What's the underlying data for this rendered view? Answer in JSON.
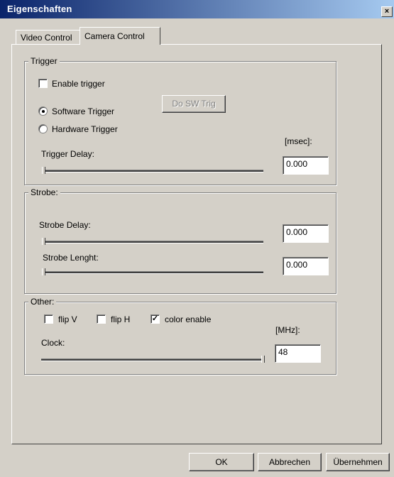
{
  "window": {
    "title": "Eigenschaften",
    "close_label": "×"
  },
  "tabs": [
    {
      "label": "Video Control"
    },
    {
      "label": "Camera Control"
    }
  ],
  "trigger": {
    "group_label": "Trigger",
    "enable_label": "Enable trigger",
    "enable_checked": false,
    "software_label": "Software Trigger",
    "hardware_label": "Hardware Trigger",
    "selected_mode": "Software Trigger",
    "do_sw_trig_label": "Do SW Trig",
    "unit_label": "[msec]:",
    "delay_label": "Trigger Delay:",
    "delay_value": "0.000",
    "delay_slider_fraction": 0.0
  },
  "strobe": {
    "group_label": "Strobe:",
    "delay_label": "Strobe Delay:",
    "delay_value": "0.000",
    "delay_slider_fraction": 0.0,
    "length_label": "Strobe Lenght:",
    "length_value": "0.000",
    "length_slider_fraction": 0.0
  },
  "other": {
    "group_label": "Other:",
    "flip_v_label": "flip V",
    "flip_v_checked": false,
    "flip_h_label": "flip H",
    "flip_h_checked": false,
    "color_enable_label": "color enable",
    "color_enable_checked": true,
    "unit_label": "[MHz]:",
    "clock_label": "Clock:",
    "clock_value": "48",
    "clock_slider_fraction": 1.0
  },
  "footer": {
    "ok_label": "OK",
    "cancel_label": "Abbrechen",
    "apply_label": "Übernehmen"
  }
}
